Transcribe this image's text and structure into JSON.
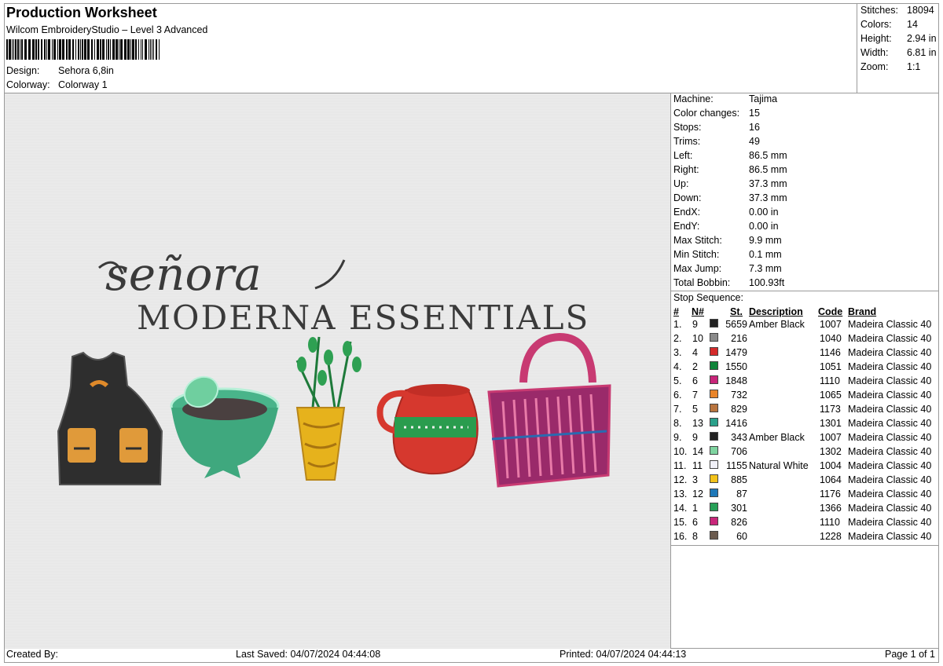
{
  "header": {
    "title": "Production Worksheet",
    "subtitle": "Wilcom EmbroideryStudio – Level 3 Advanced",
    "design_label": "Design:",
    "design_value": "Sehora 6,8in",
    "colorway_label": "Colorway:",
    "colorway_value": "Colorway 1"
  },
  "stats": [
    {
      "label": "Stitches:",
      "value": "18094"
    },
    {
      "label": "Colors:",
      "value": "14"
    },
    {
      "label": "Height:",
      "value": "2.94 in"
    },
    {
      "label": "Width:",
      "value": "6.81 in"
    },
    {
      "label": "Zoom:",
      "value": "1:1"
    }
  ],
  "design_preview": {
    "script_text": "señora",
    "title_text": "MODERNA ESSENTIALS"
  },
  "machine": [
    {
      "label": "Machine:",
      "value": "Tajima"
    },
    {
      "label": "Color changes:",
      "value": "15"
    },
    {
      "label": "Stops:",
      "value": "16"
    },
    {
      "label": "Trims:",
      "value": "49"
    },
    {
      "label": "Left:",
      "value": "86.5 mm"
    },
    {
      "label": "Right:",
      "value": "86.5 mm"
    },
    {
      "label": "Up:",
      "value": "37.3 mm"
    },
    {
      "label": "Down:",
      "value": "37.3 mm"
    },
    {
      "label": "EndX:",
      "value": "0.00 in"
    },
    {
      "label": "EndY:",
      "value": "0.00 in"
    },
    {
      "label": "Max Stitch:",
      "value": "9.9 mm"
    },
    {
      "label": "Min Stitch:",
      "value": "0.1 mm"
    },
    {
      "label": "Max Jump:",
      "value": "7.3 mm"
    },
    {
      "label": "Total Bobbin:",
      "value": "100.93ft"
    }
  ],
  "stop_sequence": {
    "label": "Stop Sequence:",
    "headers": {
      "num": "#",
      "n": "N#",
      "st": "St.",
      "desc": "Description",
      "code": "Code",
      "brand": "Brand"
    },
    "rows": [
      {
        "num": "1.",
        "n": "9",
        "color": "#222222",
        "st": "5659",
        "desc": "Amber Black",
        "code": "1007",
        "brand": "Madeira Classic 40"
      },
      {
        "num": "2.",
        "n": "10",
        "color": "#8a8a8a",
        "st": "216",
        "desc": "",
        "code": "1040",
        "brand": "Madeira Classic 40"
      },
      {
        "num": "3.",
        "n": "4",
        "color": "#d42a2a",
        "st": "1479",
        "desc": "",
        "code": "1146",
        "brand": "Madeira Classic 40"
      },
      {
        "num": "4.",
        "n": "2",
        "color": "#10843a",
        "st": "1550",
        "desc": "",
        "code": "1051",
        "brand": "Madeira Classic 40"
      },
      {
        "num": "5.",
        "n": "6",
        "color": "#c8267a",
        "st": "1848",
        "desc": "",
        "code": "1110",
        "brand": "Madeira Classic 40"
      },
      {
        "num": "6.",
        "n": "7",
        "color": "#e8842a",
        "st": "732",
        "desc": "",
        "code": "1065",
        "brand": "Madeira Classic 40"
      },
      {
        "num": "7.",
        "n": "5",
        "color": "#b8743e",
        "st": "829",
        "desc": "",
        "code": "1173",
        "brand": "Madeira Classic 40"
      },
      {
        "num": "8.",
        "n": "13",
        "color": "#2aa08a",
        "st": "1416",
        "desc": "",
        "code": "1301",
        "brand": "Madeira Classic 40"
      },
      {
        "num": "9.",
        "n": "9",
        "color": "#222222",
        "st": "343",
        "desc": "Amber Black",
        "code": "1007",
        "brand": "Madeira Classic 40"
      },
      {
        "num": "10.",
        "n": "14",
        "color": "#7fd4a0",
        "st": "706",
        "desc": "",
        "code": "1302",
        "brand": "Madeira Classic 40"
      },
      {
        "num": "11.",
        "n": "11",
        "color": "#f0f0f8",
        "st": "1155",
        "desc": "Natural White",
        "code": "1004",
        "brand": "Madeira Classic 40"
      },
      {
        "num": "12.",
        "n": "3",
        "color": "#f2c21a",
        "st": "885",
        "desc": "",
        "code": "1064",
        "brand": "Madeira Classic 40"
      },
      {
        "num": "13.",
        "n": "12",
        "color": "#1e78b8",
        "st": "87",
        "desc": "",
        "code": "1176",
        "brand": "Madeira Classic 40"
      },
      {
        "num": "14.",
        "n": "1",
        "color": "#28a058",
        "st": "301",
        "desc": "",
        "code": "1366",
        "brand": "Madeira Classic 40"
      },
      {
        "num": "15.",
        "n": "6",
        "color": "#c8267a",
        "st": "826",
        "desc": "",
        "code": "1110",
        "brand": "Madeira Classic 40"
      },
      {
        "num": "16.",
        "n": "8",
        "color": "#6a5a4e",
        "st": "60",
        "desc": "",
        "code": "1228",
        "brand": "Madeira Classic 40"
      }
    ]
  },
  "footer": {
    "created_by": "Created By:",
    "last_saved": "Last Saved: 04/07/2024 04:44:08",
    "printed": "Printed: 04/07/2024 04:44:13",
    "page": "Page 1 of 1"
  }
}
